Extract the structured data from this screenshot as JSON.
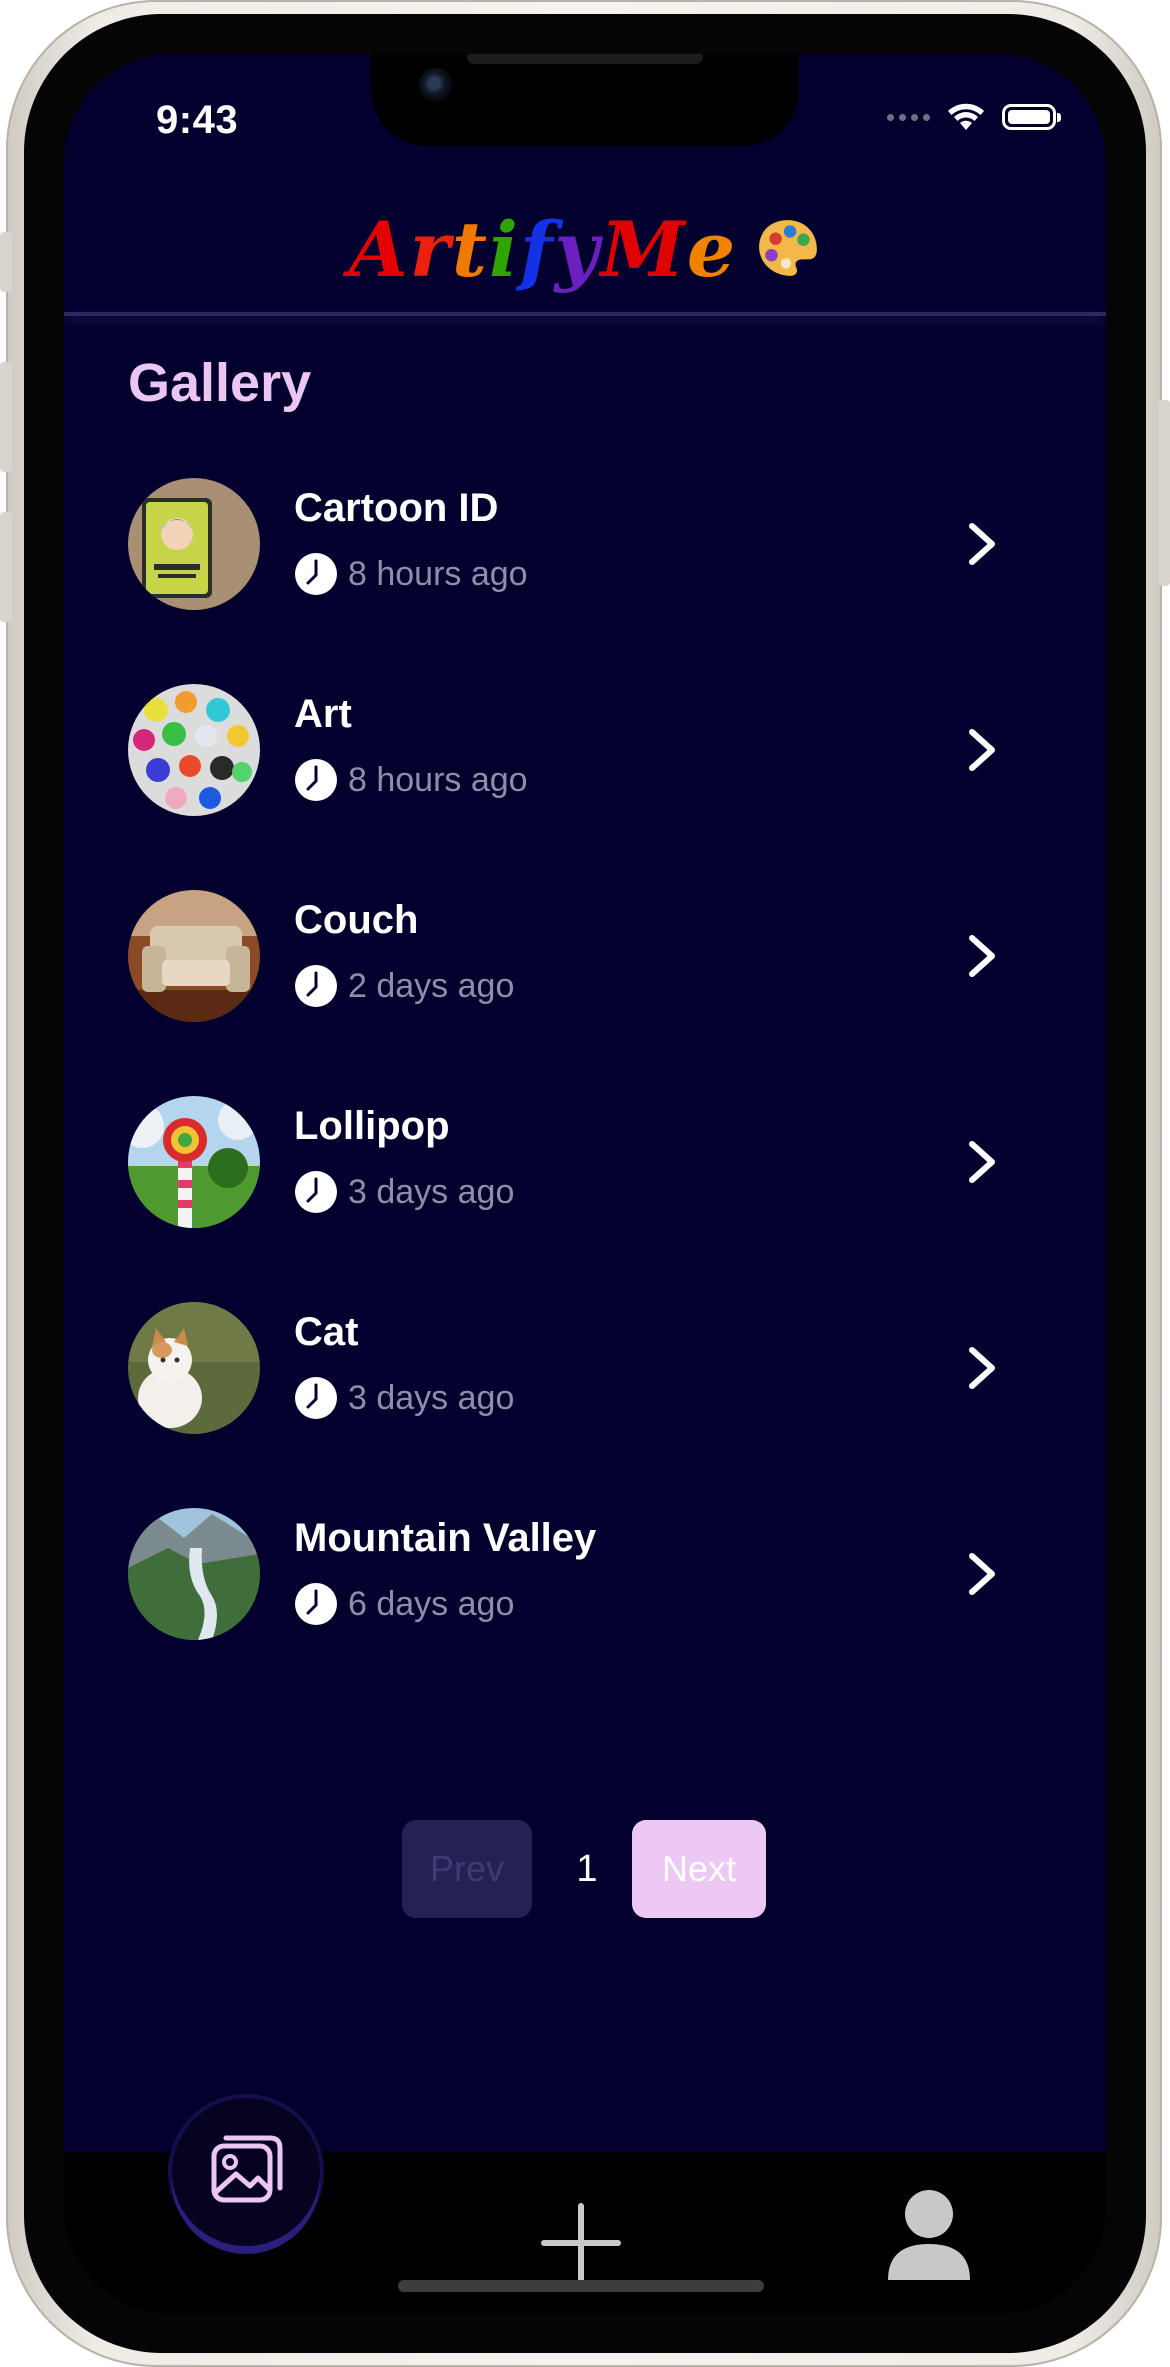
{
  "status_bar": {
    "time": "9:43"
  },
  "header": {
    "logo_letters": [
      {
        "ch": "A",
        "color": "#e40000"
      },
      {
        "ch": "r",
        "color": "#ef1f10"
      },
      {
        "ch": "t",
        "color": "#f07a00"
      },
      {
        "ch": "i",
        "color": "#2fa300"
      },
      {
        "ch": "f",
        "color": "#1431e8"
      },
      {
        "ch": "y",
        "color": "#6a1fbf"
      },
      {
        "ch": "M",
        "color": "#e00000"
      },
      {
        "ch": "e",
        "color": "#f08200"
      }
    ],
    "logo_icon": "palette-icon"
  },
  "gallery": {
    "title": "Gallery",
    "items": [
      {
        "title": "Cartoon ID",
        "time": "8 hours ago",
        "thumb": "cartoon-id-thumbnail"
      },
      {
        "title": "Art",
        "time": "8 hours ago",
        "thumb": "art-thumbnail"
      },
      {
        "title": "Couch",
        "time": "2 days ago",
        "thumb": "couch-thumbnail"
      },
      {
        "title": "Lollipop",
        "time": "3 days ago",
        "thumb": "lollipop-thumbnail"
      },
      {
        "title": "Cat",
        "time": "3 days ago",
        "thumb": "cat-thumbnail"
      },
      {
        "title": "Mountain Valley",
        "time": "6 days ago",
        "thumb": "mountain-valley-thumbnail"
      }
    ]
  },
  "pagination": {
    "prev_label": "Prev",
    "page": "1",
    "next_label": "Next"
  },
  "tabbar": {
    "tabs": [
      {
        "name": "gallery",
        "icon": "image-icon",
        "active": true
      },
      {
        "name": "create",
        "icon": "plus-icon",
        "active": false
      },
      {
        "name": "profile",
        "icon": "user-icon",
        "active": false
      }
    ]
  },
  "colors": {
    "background": "#03002e",
    "accent": "#edc8f4",
    "title": "#ecc6f2",
    "muted_text": "#8f8ea9"
  }
}
